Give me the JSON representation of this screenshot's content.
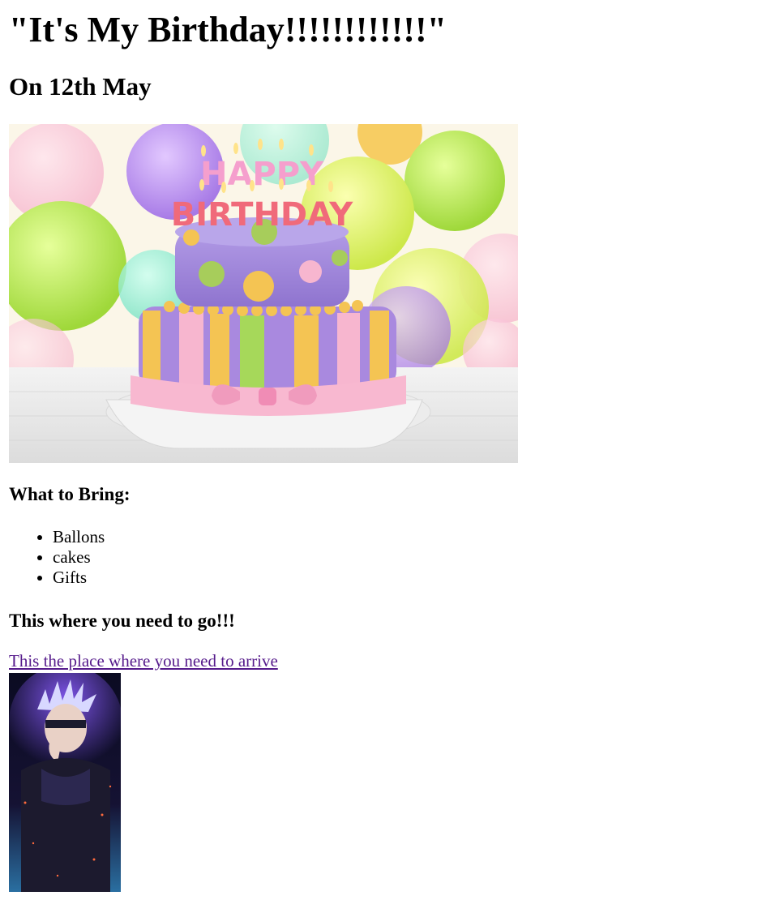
{
  "header": {
    "title": "\"It's My Birthday!!!!!!!!!!!!\"",
    "date": "On 12th May"
  },
  "hero_image": {
    "description_icon": "birthday-cake-image",
    "candle_letters_top": "HAPPY",
    "candle_letters_bottom": "BIRTHDAY"
  },
  "bring": {
    "heading": "What to Bring:",
    "items": [
      "Ballons",
      "cakes",
      "Gifts"
    ]
  },
  "directions": {
    "heading": "This where you need to go!!!",
    "link_text": "This the place where you need to arrive"
  },
  "colors": {
    "link_visited": "#551a8b",
    "cake_purple": "#a78bd8",
    "cake_pink": "#f5b7cf"
  }
}
